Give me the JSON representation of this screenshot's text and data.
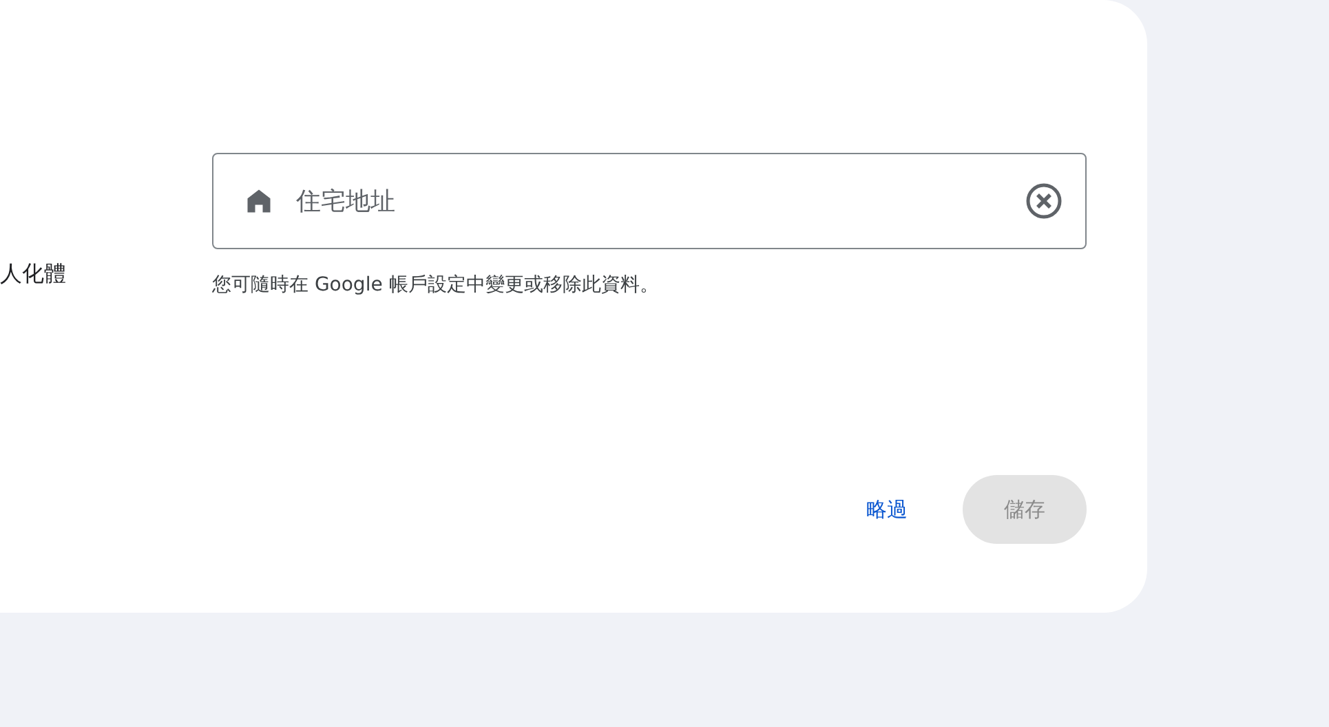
{
  "side_label": "人化體",
  "address_field": {
    "placeholder": "住宅地址"
  },
  "helper_text": "您可隨時在 Google 帳戶設定中變更或移除此資料。",
  "buttons": [
    {
      "label": "略過",
      "kind": "text",
      "disabled": false
    },
    {
      "label": "儲存",
      "kind": "filled",
      "disabled": true
    }
  ]
}
